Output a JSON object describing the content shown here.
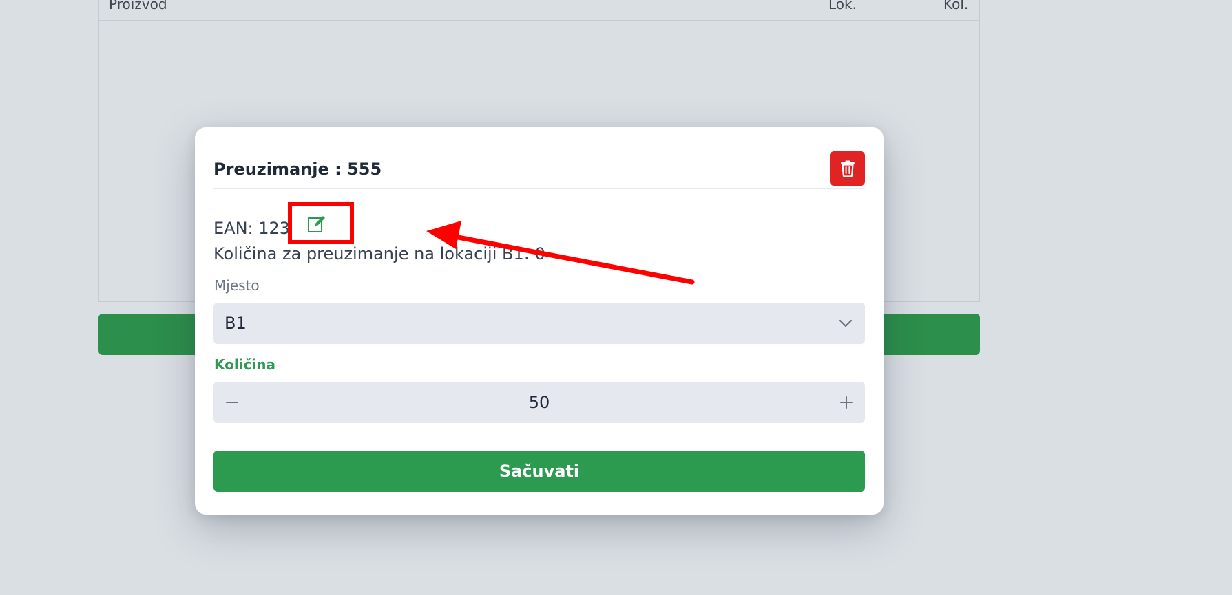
{
  "background_table": {
    "columns": [
      "Proizvod",
      "Lok.",
      "Kol."
    ]
  },
  "modal": {
    "title": "Preuzimanje : 555",
    "ean_prefix": "EAN: 123",
    "quantity_info": "Količina za preuzimanje na lokaciji B1: 0",
    "location_label": "Mjesto",
    "location_value": "B1",
    "quantity_label": "Količina",
    "quantity_value": "50",
    "save_label": "Sačuvati"
  },
  "icons": {
    "delete": "trash-icon",
    "edit": "edit-icon",
    "chevron": "chevron-down-icon",
    "minus": "minus-icon",
    "plus": "plus-icon"
  },
  "colors": {
    "accent_green": "#2c9a4f",
    "danger_red": "#e02424",
    "annotation_red": "#ff0000"
  }
}
